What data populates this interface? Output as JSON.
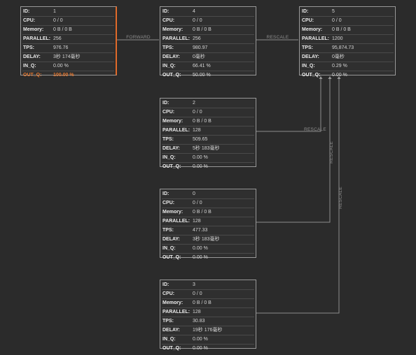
{
  "nodes": [
    {
      "node_id": "1",
      "rows": [
        {
          "label": "ID:",
          "value": "1"
        },
        {
          "label": "CPU:",
          "value": "0 / 0"
        },
        {
          "label": "Memory:",
          "value": "0 B / 0 B"
        },
        {
          "label": "PARALLEL:",
          "value": "256"
        },
        {
          "label": "TPS:",
          "value": "976.76"
        },
        {
          "label": "DELAY:",
          "value": "3秒 174毫秒"
        },
        {
          "label": "IN_Q:",
          "value": "0.00 %"
        },
        {
          "label": "OUT_Q:",
          "value": "100.00 %",
          "alert": true
        }
      ]
    },
    {
      "node_id": "4",
      "rows": [
        {
          "label": "ID:",
          "value": "4"
        },
        {
          "label": "CPU:",
          "value": "0 / 0"
        },
        {
          "label": "Memory:",
          "value": "0 B / 0 B"
        },
        {
          "label": "PARALLEL:",
          "value": "256"
        },
        {
          "label": "TPS:",
          "value": "980.97"
        },
        {
          "label": "DELAY:",
          "value": "0毫秒"
        },
        {
          "label": "IN_Q:",
          "value": "66.41 %"
        },
        {
          "label": "OUT_Q:",
          "value": "50.00 %"
        }
      ]
    },
    {
      "node_id": "5",
      "rows": [
        {
          "label": "ID:",
          "value": "5"
        },
        {
          "label": "CPU:",
          "value": "0 / 0"
        },
        {
          "label": "Memory:",
          "value": "0 B / 0 B"
        },
        {
          "label": "PARALLEL:",
          "value": "1200"
        },
        {
          "label": "TPS:",
          "value": "95,874.73"
        },
        {
          "label": "DELAY:",
          "value": "0毫秒"
        },
        {
          "label": "IN_Q:",
          "value": "0.29 %"
        },
        {
          "label": "OUT_Q:",
          "value": "0.00 %"
        }
      ]
    },
    {
      "node_id": "2",
      "rows": [
        {
          "label": "ID:",
          "value": "2"
        },
        {
          "label": "CPU:",
          "value": "0 / 0"
        },
        {
          "label": "Memory:",
          "value": "0 B / 0 B"
        },
        {
          "label": "PARALLEL:",
          "value": "128"
        },
        {
          "label": "TPS:",
          "value": "509.65"
        },
        {
          "label": "DELAY:",
          "value": "5秒 183毫秒"
        },
        {
          "label": "IN_Q:",
          "value": "0.00 %"
        },
        {
          "label": "OUT_Q:",
          "value": "0.00 %"
        }
      ]
    },
    {
      "node_id": "0",
      "rows": [
        {
          "label": "ID:",
          "value": "0"
        },
        {
          "label": "CPU:",
          "value": "0 / 0"
        },
        {
          "label": "Memory:",
          "value": "0 B / 0 B"
        },
        {
          "label": "PARALLEL:",
          "value": "128"
        },
        {
          "label": "TPS:",
          "value": "477.33"
        },
        {
          "label": "DELAY:",
          "value": "3秒 183毫秒"
        },
        {
          "label": "IN_Q:",
          "value": "0.00 %"
        },
        {
          "label": "OUT_Q:",
          "value": "0.00 %"
        }
      ]
    },
    {
      "node_id": "3",
      "rows": [
        {
          "label": "ID:",
          "value": "3"
        },
        {
          "label": "CPU:",
          "value": "0 / 0"
        },
        {
          "label": "Memory:",
          "value": "0 B / 0 B"
        },
        {
          "label": "PARALLEL:",
          "value": "128"
        },
        {
          "label": "TPS:",
          "value": "30.83"
        },
        {
          "label": "DELAY:",
          "value": "19秒 176毫秒"
        },
        {
          "label": "IN_Q:",
          "value": "0.00 %"
        },
        {
          "label": "OUT_Q:",
          "value": "0.00 %"
        }
      ]
    }
  ],
  "edges": [
    {
      "from": "1",
      "to": "4",
      "label": "FORWARD"
    },
    {
      "from": "4",
      "to": "5",
      "label": "RESCALE"
    },
    {
      "from": "2",
      "to": "5",
      "label": "RESCALE"
    },
    {
      "from": "0",
      "to": "5",
      "label": "RESCALE"
    },
    {
      "from": "3",
      "to": "5",
      "label": "RESCALE"
    }
  ],
  "colors": {
    "background": "#2b2b2b",
    "node_border": "#9a9a9a",
    "alert": "#e3762f",
    "edge": "#8c8c8c"
  }
}
